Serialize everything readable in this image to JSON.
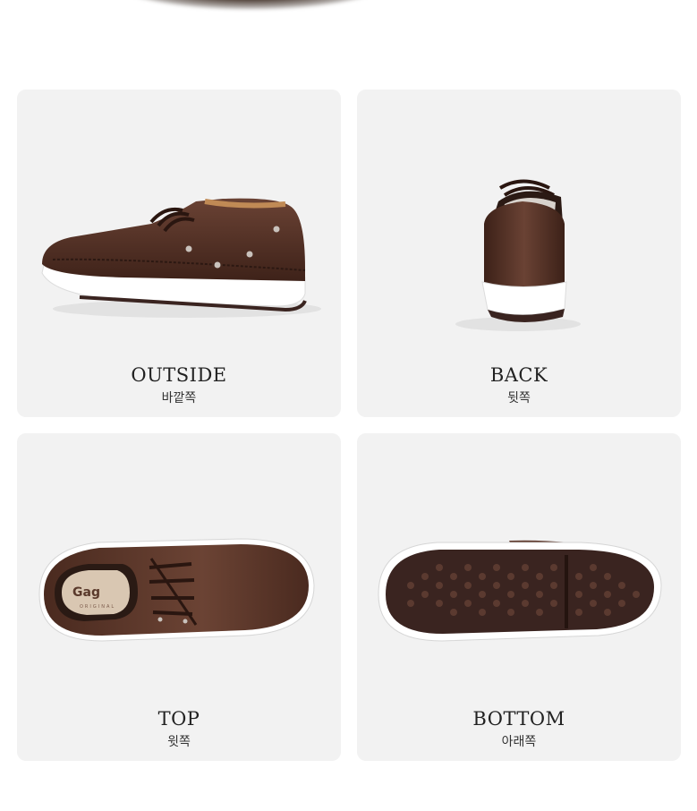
{
  "colors": {
    "card_background": "#f2f2f2",
    "leather": "#4a2a1f",
    "sole": "#ffffff",
    "outsole": "#3a2420"
  },
  "views": [
    {
      "label_en": "OUTSIDE",
      "label_ko": "바깥쪽"
    },
    {
      "label_en": "BACK",
      "label_ko": "뒷쪽"
    },
    {
      "label_en": "TOP",
      "label_ko": "윗쪽"
    },
    {
      "label_en": "BOTTOM",
      "label_ko": "아래쪽"
    }
  ],
  "insole_brand": "Gag",
  "insole_sub": "ORIGINAL"
}
